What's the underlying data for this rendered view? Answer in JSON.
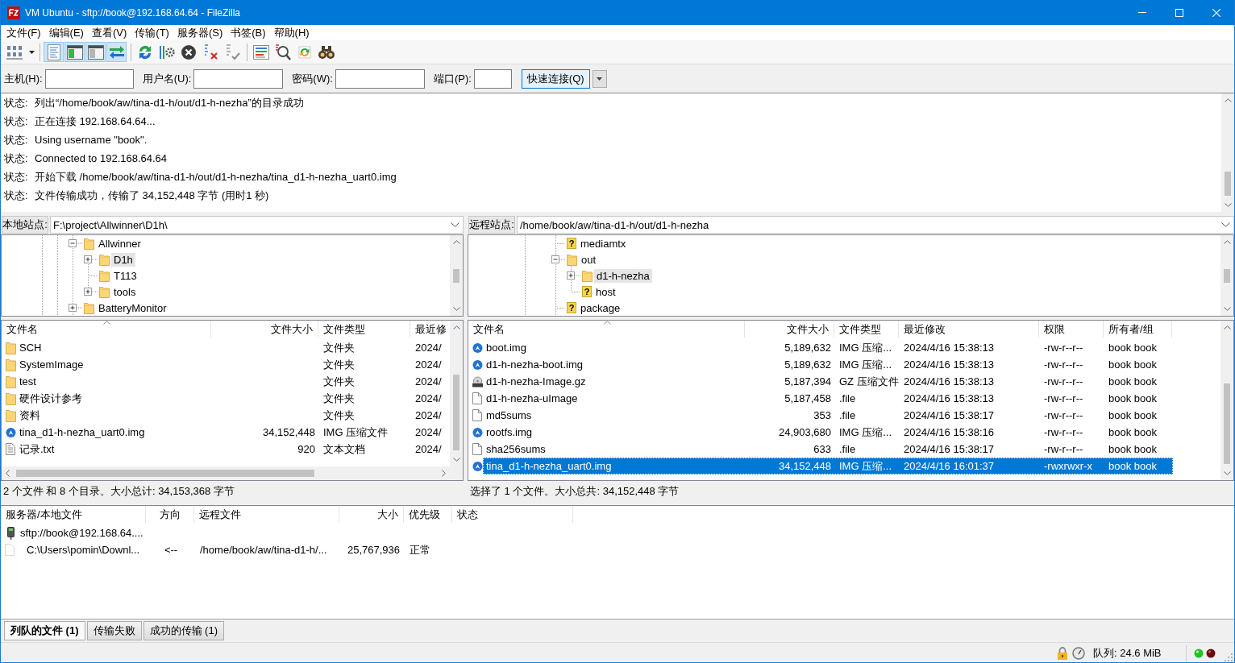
{
  "window": {
    "title": "VM Ubuntu - sftp://book@192.168.64.64 - FileZilla"
  },
  "menu": [
    "文件(F)",
    "编辑(E)",
    "查看(V)",
    "传输(T)",
    "服务器(S)",
    "书签(B)",
    "帮助(H)"
  ],
  "toolbar": {
    "view_toggles": [
      {
        "pressed": true
      },
      {
        "pressed": true
      },
      {
        "pressed": true
      },
      {
        "pressed": true
      }
    ]
  },
  "quickconnect": {
    "fields": [
      {
        "kind": "host",
        "label": "主机(H):"
      },
      {
        "kind": "user",
        "label": "用户名(U):"
      },
      {
        "kind": "password",
        "label": "密码(W):"
      },
      {
        "kind": "port",
        "label": "端口(P):"
      }
    ],
    "button": "快速连接(Q)"
  },
  "log": [
    {
      "label": "状态:",
      "text": "列出“/home/book/aw/tina-d1-h/out/d1-h-nezha”的目录成功"
    },
    {
      "label": "状态:",
      "text": "正在连接 192.168.64.64..."
    },
    {
      "label": "状态:",
      "text": "Using username \"book\"."
    },
    {
      "label": "状态:",
      "text": "Connected to 192.168.64.64"
    },
    {
      "label": "状态:",
      "text": "开始下载 /home/book/aw/tina-d1-h/out/d1-h-nezha/tina_d1-h-nezha_uart0.img"
    },
    {
      "label": "状态:",
      "text": "文件传输成功，传输了 34,152,448 字节 (用时1 秒)"
    }
  ],
  "local": {
    "site_label": "本地站点:",
    "path": "F:\\project\\Allwinner\\D1h\\",
    "tree": [
      {
        "label": "Allwinner",
        "expanded": true,
        "selected": false,
        "children": [
          {
            "label": "D1h",
            "expanded": false,
            "selected": true
          },
          {
            "label": "T113",
            "selected": false
          },
          {
            "label": "tools",
            "expanded": false,
            "selected": false
          }
        ]
      },
      {
        "label": "BatteryMonitor",
        "expanded": false,
        "selected": false
      }
    ],
    "columns": [
      "文件名",
      "文件大小",
      "文件类型",
      "最近修"
    ],
    "rows": [
      {
        "kind": "folder",
        "name": "SCH",
        "type": "文件夹",
        "modified": "2024/",
        "selected": false
      },
      {
        "kind": "folder",
        "name": "SystemImage",
        "type": "文件夹",
        "modified": "2024/",
        "selected": false
      },
      {
        "kind": "folder",
        "name": "test",
        "type": "文件夹",
        "modified": "2024/",
        "selected": false
      },
      {
        "kind": "folder",
        "name": "硬件设计参考",
        "type": "文件夹",
        "modified": "2024/",
        "selected": false
      },
      {
        "kind": "folder",
        "name": "资料",
        "type": "文件夹",
        "modified": "2024/",
        "selected": false
      },
      {
        "kind": "image",
        "name": "tina_d1-h-nezha_uart0.img",
        "size": "34,152,448",
        "type": "IMG 压缩文件",
        "modified": "2024/",
        "selected": false
      },
      {
        "kind": "text",
        "name": "记录.txt",
        "size": "920",
        "type": "文本文档",
        "modified": "2024/",
        "selected": false
      }
    ],
    "summary": "2 个文件 和 8 个目录。大小总计: 34,153,368 字节"
  },
  "remote": {
    "site_label": "远程站点:",
    "path": "/home/book/aw/tina-d1-h/out/d1-h-nezha",
    "tree": [
      {
        "label": "mediamtx",
        "glyph": "?",
        "selected": false
      },
      {
        "label": "out",
        "expanded": true,
        "selected": false,
        "children": [
          {
            "label": "d1-h-nezha",
            "expanded": false,
            "selected": true
          },
          {
            "label": "host",
            "glyph": "?",
            "selected": false
          }
        ]
      },
      {
        "label": "package",
        "glyph": "?",
        "selected": false
      }
    ],
    "columns": [
      "文件名",
      "文件大小",
      "文件类型",
      "最近修改",
      "权限",
      "所有者/组"
    ],
    "rows": [
      {
        "kind": "image",
        "name": "boot.img",
        "size": "5,189,632",
        "type": "IMG 压缩...",
        "modified": "2024/4/16 15:38:13",
        "permissions": "-rw-r--r--",
        "owner": "book book",
        "selected": false
      },
      {
        "kind": "image",
        "name": "d1-h-nezha-boot.img",
        "size": "5,189,632",
        "type": "IMG 压缩...",
        "modified": "2024/4/16 15:38:13",
        "permissions": "-rw-r--r--",
        "owner": "book book",
        "selected": false
      },
      {
        "kind": "archive",
        "name": "d1-h-nezha-Image.gz",
        "size": "5,187,394",
        "type": "GZ 压缩文件",
        "modified": "2024/4/16 15:38:13",
        "permissions": "-rw-r--r--",
        "owner": "book book",
        "selected": false
      },
      {
        "kind": "file",
        "name": "d1-h-nezha-uImage",
        "size": "5,187,458",
        "type": ".file",
        "modified": "2024/4/16 15:38:13",
        "permissions": "-rw-r--r--",
        "owner": "book book",
        "selected": false
      },
      {
        "kind": "file",
        "name": "md5sums",
        "size": "353",
        "type": ".file",
        "modified": "2024/4/16 15:38:17",
        "permissions": "-rw-r--r--",
        "owner": "book book",
        "selected": false
      },
      {
        "kind": "image",
        "name": "rootfs.img",
        "size": "24,903,680",
        "type": "IMG 压缩...",
        "modified": "2024/4/16 15:38:16",
        "permissions": "-rw-r--r--",
        "owner": "book book",
        "selected": false
      },
      {
        "kind": "file",
        "name": "sha256sums",
        "size": "633",
        "type": ".file",
        "modified": "2024/4/16 15:38:17",
        "permissions": "-rw-r--r--",
        "owner": "book book",
        "selected": false
      },
      {
        "kind": "image",
        "name": "tina_d1-h-nezha_uart0.img",
        "size": "34,152,448",
        "type": "IMG 压缩...",
        "modified": "2024/4/16 16:01:37",
        "permissions": "-rwxrwxr-x",
        "owner": "book book",
        "selected": true
      }
    ],
    "summary": "选择了 1 个文件。大小总共: 34,152,448 字节"
  },
  "queue": {
    "columns": [
      "服务器/本地文件",
      "方向",
      "远程文件",
      "大小",
      "优先级",
      "状态"
    ],
    "servers": [
      {
        "name": "sftp://book@192.168.64....",
        "files": [
          {
            "local": "C:\\Users\\pomin\\Downl...",
            "direction": "<--",
            "remote": "/home/book/aw/tina-d1-h/...",
            "size": "25,767,936",
            "priority": "正常"
          }
        ]
      }
    ]
  },
  "tabs": [
    {
      "label": "列队的文件 (1)",
      "selected": true
    },
    {
      "label": "传输失败",
      "selected": false
    },
    {
      "label": "成功的传输 (1)",
      "selected": false
    }
  ],
  "status_bar": {
    "queue": "队列: 24.6 MiB"
  }
}
